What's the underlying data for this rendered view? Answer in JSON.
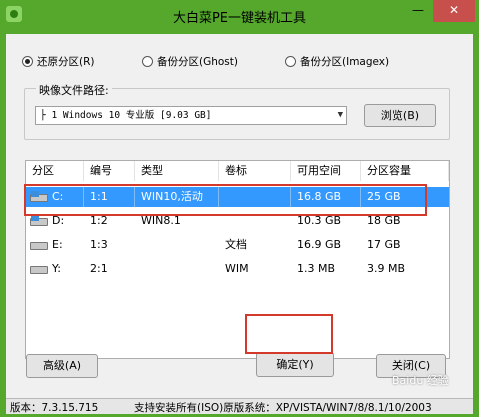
{
  "window": {
    "title": "大白菜PE一键装机工具",
    "minimize_glyph": "—",
    "close_glyph": "✕"
  },
  "modes": [
    {
      "label": "还原分区(R)",
      "selected": true
    },
    {
      "label": "备份分区(Ghost)",
      "selected": false
    },
    {
      "label": "备份分区(Imagex)",
      "selected": false
    }
  ],
  "image_path": {
    "group_label": "映像文件路径:",
    "value": "├ 1 Windows 10 专业版 [9.03 GB]",
    "browse_label": "浏览(B)"
  },
  "table": {
    "headers": [
      "分区",
      "编号",
      "类型",
      "卷标",
      "可用空间",
      "分区容量"
    ],
    "rows": [
      {
        "drive": "C:",
        "num": "1:1",
        "type": "WIN10,活动",
        "label": "",
        "free": "16.8 GB",
        "size": "25 GB",
        "selected": true,
        "icon": "windows-drive-icon"
      },
      {
        "drive": "D:",
        "num": "1:2",
        "type": "WIN8.1",
        "label": "",
        "free": "10.3 GB",
        "size": "18 GB",
        "selected": false,
        "icon": "windows-drive-icon"
      },
      {
        "drive": "E:",
        "num": "1:3",
        "type": "",
        "label": "文档",
        "free": "16.9 GB",
        "size": "17 GB",
        "selected": false,
        "icon": "drive-icon"
      },
      {
        "drive": "Y:",
        "num": "2:1",
        "type": "",
        "label": "WIM",
        "free": "1.3 MB",
        "size": "3.9 MB",
        "selected": false,
        "icon": "drive-icon"
      }
    ]
  },
  "buttons": {
    "advanced": "高级(A)",
    "ok": "确定(Y)",
    "cancel": "关闭(C)"
  },
  "status": {
    "version": "版本：7.3.15.715",
    "support": "支持安装所有(ISO)原版系统：XP/VISTA/WIN7/8/8.1/10/2003"
  },
  "watermark": "Baidu 经验",
  "colors": {
    "title_bar": "#55a82c",
    "close_button": "#c7504c",
    "selection": "#3399ff",
    "annotation_box": "#d33a2c"
  }
}
